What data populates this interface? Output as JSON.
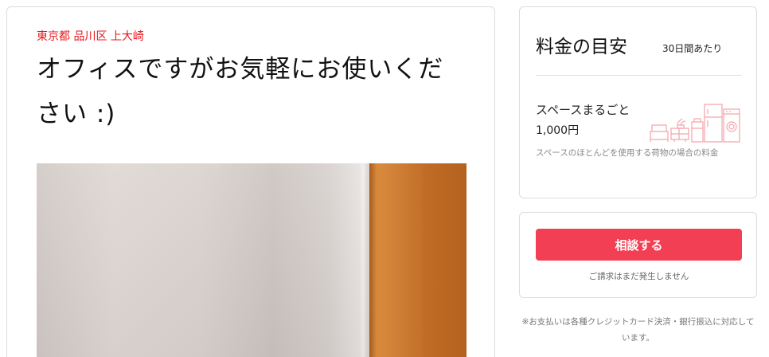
{
  "listing": {
    "location": "東京都 品川区 上大崎",
    "title": "オフィスですがお気軽にお使いください :)"
  },
  "pricing": {
    "heading": "料金の目安",
    "period": "30日間あたり",
    "plan_name": "スペースまるごと",
    "plan_price": "1,000円",
    "plan_note": "スペースのほとんどを使用する荷物の場合の料金",
    "plan_icon": "furniture-icon"
  },
  "action": {
    "consult_label": "相談する",
    "billing_note": "ご請求はまだ発生しません"
  },
  "payment_note": "※お支払いは各種クレジットカード決済・銀行振込に対応しています。",
  "colors": {
    "accent": "#f23f53",
    "location": "#e8161c"
  }
}
